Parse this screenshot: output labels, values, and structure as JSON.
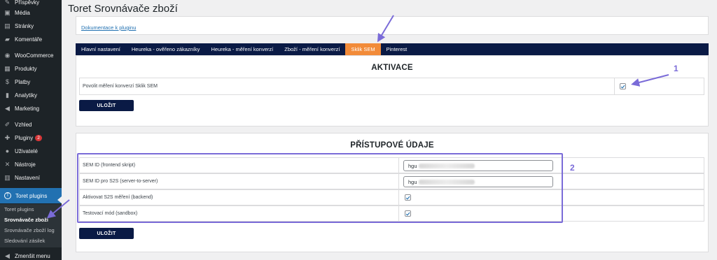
{
  "sidebar": {
    "items": [
      {
        "label": "Příspěvky",
        "icon": "pin-icon"
      },
      {
        "label": "Média",
        "icon": "media-icon"
      },
      {
        "label": "Stránky",
        "icon": "pages-icon"
      },
      {
        "label": "Komentáře",
        "icon": "comments-icon"
      },
      {
        "label": "WooCommerce",
        "icon": "woocommerce-icon"
      },
      {
        "label": "Produkty",
        "icon": "products-icon"
      },
      {
        "label": "Platby",
        "icon": "payments-icon"
      },
      {
        "label": "Analytiky",
        "icon": "analytics-icon"
      },
      {
        "label": "Marketing",
        "icon": "megaphone-icon"
      },
      {
        "label": "Vzhled",
        "icon": "brush-icon"
      },
      {
        "label": "Pluginy",
        "icon": "plugin-icon",
        "badge": "2"
      },
      {
        "label": "Uživatelé",
        "icon": "users-icon"
      },
      {
        "label": "Nástroje",
        "icon": "tools-icon"
      },
      {
        "label": "Nastavení",
        "icon": "settings-icon"
      },
      {
        "label": "Toret plugins",
        "icon": "toret-icon"
      }
    ],
    "submenu": [
      "Toret plugins",
      "Srovnávače zboží",
      "Srovnávače zboží log",
      "Sledování zásilek"
    ],
    "collapse_label": "Zmenšit menu"
  },
  "page": {
    "title": "Toret Srovnávače zboží",
    "doc_link": "Dokumentace k pluginu"
  },
  "tabs": [
    "Hlavní nastavení",
    "Heureka - ověřeno zákazníky",
    "Heureka - měření konverzí",
    "Zboží - měření konverzí",
    "Sklik SEM",
    "Pinterest"
  ],
  "activation": {
    "title": "AKTIVACE",
    "row_label": "Povolit měření konverzí Sklik SEM",
    "checked": true,
    "save_label": "ULOŽIT"
  },
  "credentials": {
    "title": "PŘÍSTUPOVÉ ÚDAJE",
    "rows": [
      {
        "label": "SEM ID (frontend skript)",
        "value": "hgu"
      },
      {
        "label": "SEM ID pro S2S (server-to-server)",
        "value": "hgu"
      },
      {
        "label": "Aktivovat S2S měření (backend)",
        "checked": true
      },
      {
        "label": "Testovací mód (sandbox)",
        "checked": true
      }
    ],
    "save_label": "ULOŽIT"
  },
  "annotations": {
    "callout_1": "1",
    "callout_2": "2"
  },
  "colors": {
    "admin_bar": "#1d2327",
    "active_menu": "#2271b1",
    "tab_bar": "#0a1a45",
    "active_tab": "#f28b39",
    "annotation": "#7a6bd8"
  }
}
